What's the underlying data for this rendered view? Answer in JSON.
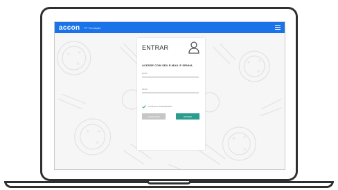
{
  "app": {
    "logo": "accon",
    "subtitle": "PF Fundação"
  },
  "login": {
    "title": "ENTRAR",
    "subtitle": "ACESSE COM SEU E-MAIL E SENHA",
    "email_label": "E-mail",
    "password_label": "Senha",
    "remember_label": "Lembrar-me neste dispositivo",
    "register_button": "CADASTRAR",
    "login_button": "ENTRAR"
  },
  "colors": {
    "app_bar": "#1a73e8",
    "primary_button": "#2a9d8f",
    "secondary_button": "#c6c6c6"
  }
}
